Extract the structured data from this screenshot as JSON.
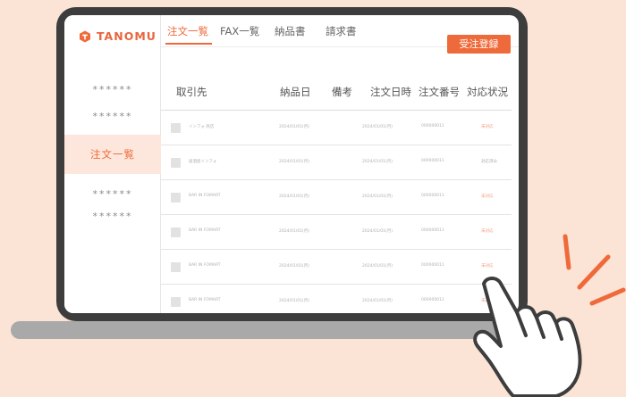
{
  "app": {
    "logo_text": "TANOMU",
    "brand_color": "#ef6a3a"
  },
  "tabs": [
    {
      "label": "注文一覧",
      "active": true
    },
    {
      "label": "FAX一覧",
      "active": false
    },
    {
      "label": "納品書",
      "active": false
    },
    {
      "label": "請求書",
      "active": false
    }
  ],
  "actions": {
    "order_register": "受注登録"
  },
  "sidebar": {
    "items": [
      {
        "label": "******"
      },
      {
        "label": "******"
      },
      {
        "label": "注文一覧",
        "active": true
      },
      {
        "label": "******"
      },
      {
        "label": "******"
      }
    ]
  },
  "table": {
    "columns": [
      "取引先",
      "納品日",
      "備考",
      "注文日時",
      "注文番号",
      "対応状況"
    ],
    "rows": [
      {
        "customer": "インフォ 商店",
        "delivery": "2024/01/01(月)",
        "note": "",
        "ordered": "2024/01/01(月)",
        "number": "000000011",
        "status": "未対応"
      },
      {
        "customer": "居酒屋インフォ",
        "delivery": "2024/01/01(月)",
        "note": "",
        "ordered": "2024/01/01(月)",
        "number": "000000011",
        "status": "対応済み"
      },
      {
        "customer": "BAR IN FOMART",
        "delivery": "2024/01/01(月)",
        "note": "",
        "ordered": "2024/01/01(月)",
        "number": "000000011",
        "status": "未対応"
      },
      {
        "customer": "BAR IN FOMART",
        "delivery": "2024/01/01(月)",
        "note": "",
        "ordered": "2024/01/01(月)",
        "number": "000000011",
        "status": "未対応"
      },
      {
        "customer": "BAR IN FOMART",
        "delivery": "2024/01/01(月)",
        "note": "",
        "ordered": "2024/01/01(月)",
        "number": "000000011",
        "status": "未対応"
      },
      {
        "customer": "BAR IN FOMART",
        "delivery": "2024/01/01(月)",
        "note": "",
        "ordered": "2024/01/01(月)",
        "number": "000000011",
        "status": "未対応"
      }
    ]
  },
  "icons": {
    "logo": "tanomu-logo-icon",
    "pointer": "pointing-hand-icon"
  }
}
